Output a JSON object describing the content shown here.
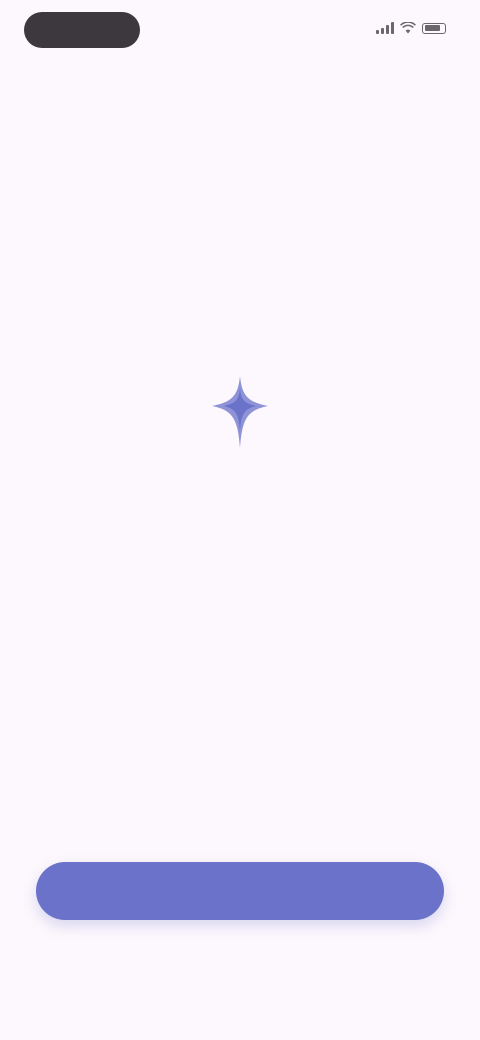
{
  "status_bar": {
    "time": "",
    "icons": [
      "signal-icon",
      "wifi-icon",
      "battery-icon"
    ]
  },
  "hero": {
    "icon": "sparkle-icon",
    "title": "",
    "subtitle": ""
  },
  "actions": {
    "primary_label": "",
    "secondary_label": ""
  },
  "colors": {
    "background": "#fdf8fd",
    "accent": "#6a72c9",
    "pill": "#3d383d",
    "text": "#2b2a30"
  }
}
